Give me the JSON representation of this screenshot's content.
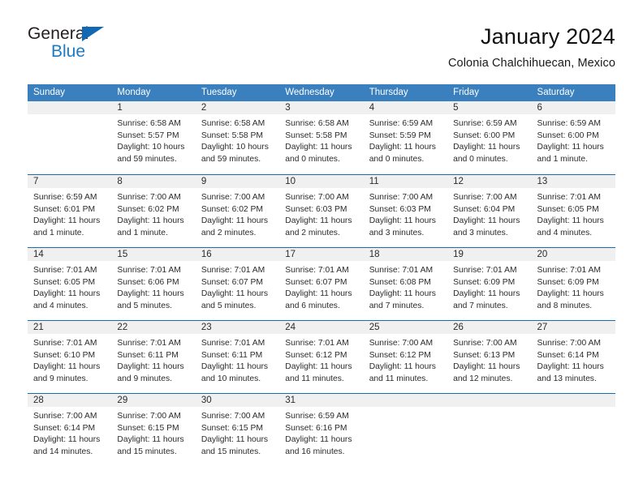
{
  "logo": {
    "word1": "General",
    "word2": "Blue",
    "triangle_icon": "triangle-icon",
    "accent_color": "#1268b3",
    "blue_text_color": "#1b7bc4"
  },
  "header": {
    "title": "January 2024",
    "location": "Colonia Chalchihuecan, Mexico"
  },
  "calendar": {
    "header_bg": "#3a7fbe",
    "daynum_band_bg": "#f0f0f0",
    "week_divider_color": "#1a6bb0",
    "weekday_names": [
      "Sunday",
      "Monday",
      "Tuesday",
      "Wednesday",
      "Thursday",
      "Friday",
      "Saturday"
    ],
    "weeks": [
      [
        {
          "day": "",
          "lines": []
        },
        {
          "day": "1",
          "lines": [
            "Sunrise: 6:58 AM",
            "Sunset: 5:57 PM",
            "Daylight: 10 hours",
            "and 59 minutes."
          ]
        },
        {
          "day": "2",
          "lines": [
            "Sunrise: 6:58 AM",
            "Sunset: 5:58 PM",
            "Daylight: 10 hours",
            "and 59 minutes."
          ]
        },
        {
          "day": "3",
          "lines": [
            "Sunrise: 6:58 AM",
            "Sunset: 5:58 PM",
            "Daylight: 11 hours",
            "and 0 minutes."
          ]
        },
        {
          "day": "4",
          "lines": [
            "Sunrise: 6:59 AM",
            "Sunset: 5:59 PM",
            "Daylight: 11 hours",
            "and 0 minutes."
          ]
        },
        {
          "day": "5",
          "lines": [
            "Sunrise: 6:59 AM",
            "Sunset: 6:00 PM",
            "Daylight: 11 hours",
            "and 0 minutes."
          ]
        },
        {
          "day": "6",
          "lines": [
            "Sunrise: 6:59 AM",
            "Sunset: 6:00 PM",
            "Daylight: 11 hours",
            "and 1 minute."
          ]
        }
      ],
      [
        {
          "day": "7",
          "lines": [
            "Sunrise: 6:59 AM",
            "Sunset: 6:01 PM",
            "Daylight: 11 hours",
            "and 1 minute."
          ]
        },
        {
          "day": "8",
          "lines": [
            "Sunrise: 7:00 AM",
            "Sunset: 6:02 PM",
            "Daylight: 11 hours",
            "and 1 minute."
          ]
        },
        {
          "day": "9",
          "lines": [
            "Sunrise: 7:00 AM",
            "Sunset: 6:02 PM",
            "Daylight: 11 hours",
            "and 2 minutes."
          ]
        },
        {
          "day": "10",
          "lines": [
            "Sunrise: 7:00 AM",
            "Sunset: 6:03 PM",
            "Daylight: 11 hours",
            "and 2 minutes."
          ]
        },
        {
          "day": "11",
          "lines": [
            "Sunrise: 7:00 AM",
            "Sunset: 6:03 PM",
            "Daylight: 11 hours",
            "and 3 minutes."
          ]
        },
        {
          "day": "12",
          "lines": [
            "Sunrise: 7:00 AM",
            "Sunset: 6:04 PM",
            "Daylight: 11 hours",
            "and 3 minutes."
          ]
        },
        {
          "day": "13",
          "lines": [
            "Sunrise: 7:01 AM",
            "Sunset: 6:05 PM",
            "Daylight: 11 hours",
            "and 4 minutes."
          ]
        }
      ],
      [
        {
          "day": "14",
          "lines": [
            "Sunrise: 7:01 AM",
            "Sunset: 6:05 PM",
            "Daylight: 11 hours",
            "and 4 minutes."
          ]
        },
        {
          "day": "15",
          "lines": [
            "Sunrise: 7:01 AM",
            "Sunset: 6:06 PM",
            "Daylight: 11 hours",
            "and 5 minutes."
          ]
        },
        {
          "day": "16",
          "lines": [
            "Sunrise: 7:01 AM",
            "Sunset: 6:07 PM",
            "Daylight: 11 hours",
            "and 5 minutes."
          ]
        },
        {
          "day": "17",
          "lines": [
            "Sunrise: 7:01 AM",
            "Sunset: 6:07 PM",
            "Daylight: 11 hours",
            "and 6 minutes."
          ]
        },
        {
          "day": "18",
          "lines": [
            "Sunrise: 7:01 AM",
            "Sunset: 6:08 PM",
            "Daylight: 11 hours",
            "and 7 minutes."
          ]
        },
        {
          "day": "19",
          "lines": [
            "Sunrise: 7:01 AM",
            "Sunset: 6:09 PM",
            "Daylight: 11 hours",
            "and 7 minutes."
          ]
        },
        {
          "day": "20",
          "lines": [
            "Sunrise: 7:01 AM",
            "Sunset: 6:09 PM",
            "Daylight: 11 hours",
            "and 8 minutes."
          ]
        }
      ],
      [
        {
          "day": "21",
          "lines": [
            "Sunrise: 7:01 AM",
            "Sunset: 6:10 PM",
            "Daylight: 11 hours",
            "and 9 minutes."
          ]
        },
        {
          "day": "22",
          "lines": [
            "Sunrise: 7:01 AM",
            "Sunset: 6:11 PM",
            "Daylight: 11 hours",
            "and 9 minutes."
          ]
        },
        {
          "day": "23",
          "lines": [
            "Sunrise: 7:01 AM",
            "Sunset: 6:11 PM",
            "Daylight: 11 hours",
            "and 10 minutes."
          ]
        },
        {
          "day": "24",
          "lines": [
            "Sunrise: 7:01 AM",
            "Sunset: 6:12 PM",
            "Daylight: 11 hours",
            "and 11 minutes."
          ]
        },
        {
          "day": "25",
          "lines": [
            "Sunrise: 7:00 AM",
            "Sunset: 6:12 PM",
            "Daylight: 11 hours",
            "and 11 minutes."
          ]
        },
        {
          "day": "26",
          "lines": [
            "Sunrise: 7:00 AM",
            "Sunset: 6:13 PM",
            "Daylight: 11 hours",
            "and 12 minutes."
          ]
        },
        {
          "day": "27",
          "lines": [
            "Sunrise: 7:00 AM",
            "Sunset: 6:14 PM",
            "Daylight: 11 hours",
            "and 13 minutes."
          ]
        }
      ],
      [
        {
          "day": "28",
          "lines": [
            "Sunrise: 7:00 AM",
            "Sunset: 6:14 PM",
            "Daylight: 11 hours",
            "and 14 minutes."
          ]
        },
        {
          "day": "29",
          "lines": [
            "Sunrise: 7:00 AM",
            "Sunset: 6:15 PM",
            "Daylight: 11 hours",
            "and 15 minutes."
          ]
        },
        {
          "day": "30",
          "lines": [
            "Sunrise: 7:00 AM",
            "Sunset: 6:15 PM",
            "Daylight: 11 hours",
            "and 15 minutes."
          ]
        },
        {
          "day": "31",
          "lines": [
            "Sunrise: 6:59 AM",
            "Sunset: 6:16 PM",
            "Daylight: 11 hours",
            "and 16 minutes."
          ]
        },
        {
          "day": "",
          "lines": []
        },
        {
          "day": "",
          "lines": []
        },
        {
          "day": "",
          "lines": []
        }
      ]
    ]
  }
}
